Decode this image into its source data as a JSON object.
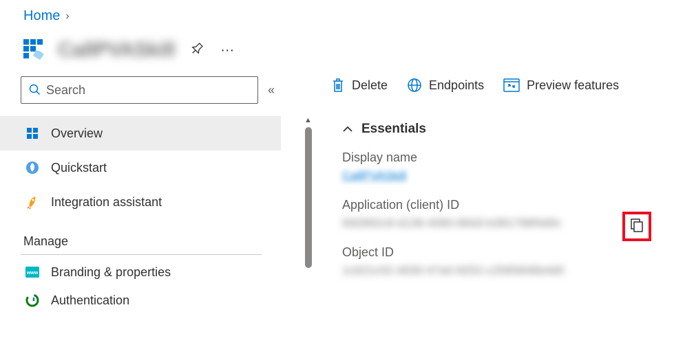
{
  "breadcrumb": {
    "home": "Home"
  },
  "header": {
    "title": "CallPVASkill"
  },
  "sidebar": {
    "search_placeholder": "Search",
    "items": [
      {
        "label": "Overview"
      },
      {
        "label": "Quickstart"
      },
      {
        "label": "Integration assistant"
      }
    ],
    "manage_header": "Manage",
    "manage_items": [
      {
        "label": "Branding & properties"
      },
      {
        "label": "Authentication"
      }
    ]
  },
  "toolbar": {
    "delete": "Delete",
    "endpoints": "Endpoints",
    "preview": "Preview features"
  },
  "essentials": {
    "title": "Essentials",
    "display_name_label": "Display name",
    "display_name_value": "CallPVASkill",
    "app_id_label": "Application (client) ID",
    "app_id_value": "692892c8-d136-4060-86d3-b381798f4d0c",
    "object_id_label": "Object ID",
    "object_id_value": "1c621c02-4630-47a0-8252-c2585846b4d0"
  }
}
